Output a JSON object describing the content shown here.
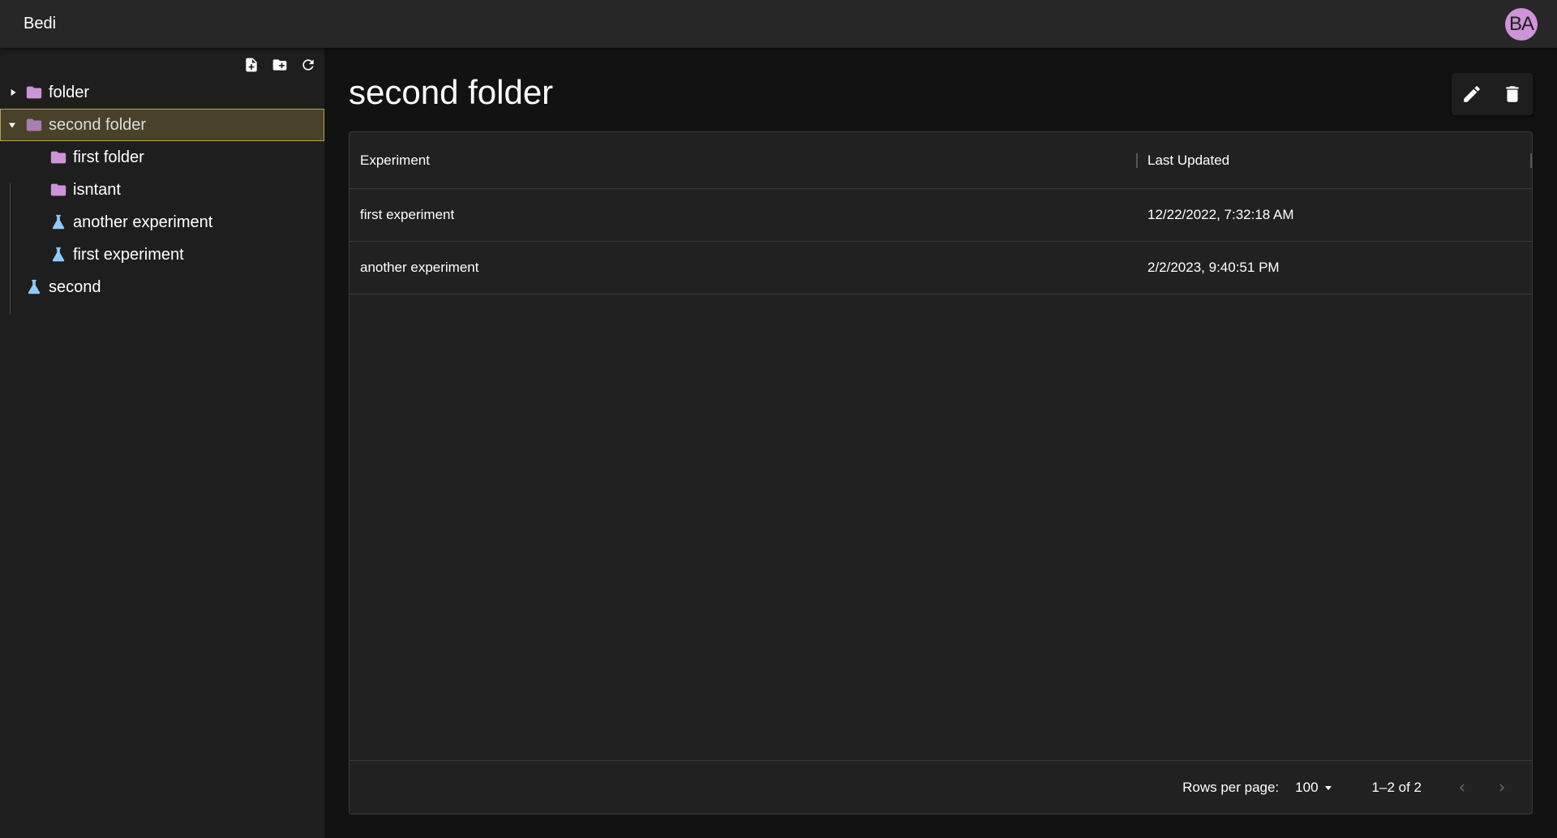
{
  "app": {
    "title": "Bedi",
    "avatar_initials": "BA",
    "avatar_color": "#ce93d8"
  },
  "sidebar": {
    "toolbar": [
      {
        "name": "new-experiment-button",
        "icon": "file-plus-icon"
      },
      {
        "name": "new-folder-button",
        "icon": "folder-plus-icon"
      },
      {
        "name": "refresh-button",
        "icon": "refresh-icon"
      }
    ],
    "tree": [
      {
        "label": "folder",
        "type": "folder",
        "depth": 0,
        "expanded": false,
        "has_children": true
      },
      {
        "label": "second folder",
        "type": "folder",
        "depth": 0,
        "expanded": true,
        "has_children": true,
        "selected": true
      },
      {
        "label": "first folder",
        "type": "folder",
        "depth": 1
      },
      {
        "label": "isntant",
        "type": "folder",
        "depth": 1
      },
      {
        "label": "another experiment",
        "type": "experiment",
        "depth": 1
      },
      {
        "label": "first experiment",
        "type": "experiment",
        "depth": 1
      },
      {
        "label": "second",
        "type": "experiment",
        "depth": 0
      }
    ]
  },
  "colors": {
    "folder": "#ce93d8",
    "experiment": "#90caf9",
    "selected_bg": "#4a412a",
    "selected_border": "#b5a256"
  },
  "main": {
    "title": "second folder",
    "actions": [
      {
        "name": "edit-button",
        "icon": "pencil-icon"
      },
      {
        "name": "delete-button",
        "icon": "trash-icon"
      }
    ]
  },
  "grid": {
    "columns": [
      "Experiment",
      "Last Updated"
    ],
    "rows": [
      [
        "first experiment",
        "12/22/2022, 7:32:18 AM"
      ],
      [
        "another experiment",
        "2/2/2023, 9:40:51 PM"
      ]
    ],
    "footer": {
      "rows_per_page_label": "Rows per page:",
      "rows_per_page": "100",
      "range": "1–2 of 2"
    }
  }
}
